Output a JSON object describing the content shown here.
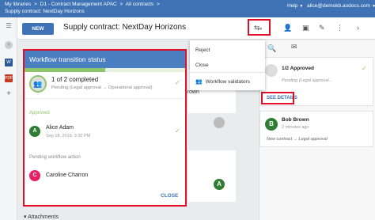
{
  "topbar": {
    "crumbs": [
      "My libraries",
      ">",
      "D1 - Contract Management APAC",
      ">",
      "All contracts",
      ">"
    ],
    "subtitle": "Supply contract: NextDay Horizons",
    "help": "Help",
    "user": "alice@demokb.aodocs.com"
  },
  "header": {
    "new_label": "NEW",
    "title": "Supply contract: NextDay Horizons"
  },
  "icons": {
    "workflow": "workflow-icon",
    "add_user": "add-user-icon",
    "folder": "move-folder-icon",
    "edit": "edit-icon",
    "more": "more-vert-icon"
  },
  "workflow_menu": {
    "items": [
      "Reject",
      "Close",
      "Workflow validators"
    ]
  },
  "dialog": {
    "title": "Workflow transition status",
    "progress_main": "1 of 2 completed",
    "progress_sub": "Pending (Legal approval → Operational approval)",
    "approved_label": "Approved",
    "approved_name": "Alice Adam",
    "approved_date": "Sep 18, 2019, 3:20 PM",
    "approved_initial": "A",
    "pending_label": "Pending workflow action",
    "pending_name": "Caroline Charron",
    "pending_initial": "C",
    "close_label": "CLOSE",
    "progress_fraction": 0.5
  },
  "right_panel": {
    "approved_count": "1/2 Approved",
    "pending_text": "Pending (Legal approval...",
    "see_details": "SEE DETAILS",
    "comment_name": "Bob Brown",
    "comment_time": "2 minutes ago",
    "comment_initial": "B",
    "comment_text": "New contract → Legal approval"
  },
  "background": {
    "brown_text": "Brown",
    "avatar_a": "A",
    "attachments": "Attachments"
  },
  "colors": {
    "brand_blue": "#3f73b5",
    "dialog_head": "#4a7fc2",
    "approve_green": "#8dc56a",
    "avatar_green": "#2e7d32",
    "avatar_pink": "#e91e63",
    "highlight_red": "#e0102a"
  }
}
